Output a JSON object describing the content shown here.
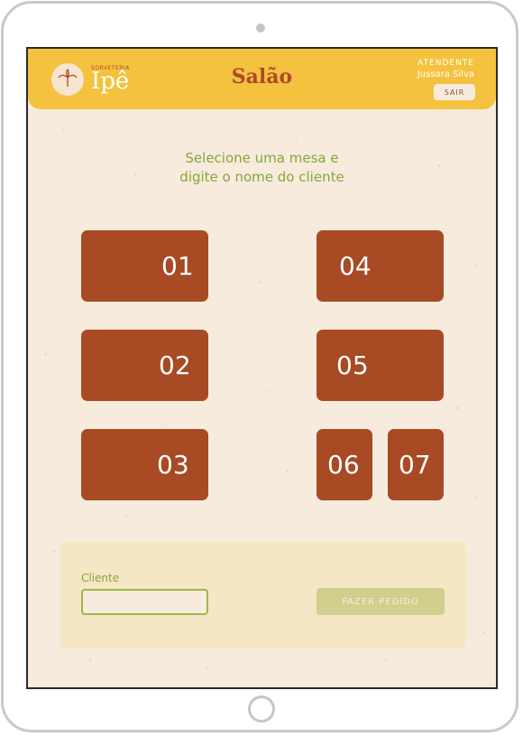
{
  "header": {
    "brand_small": "SORVETERIA",
    "brand_name": "Ipê",
    "title": "Salão",
    "attendant_label": "ATENDENTE",
    "attendant_name": "Jussara Silva",
    "logout_label": "SAIR"
  },
  "instruction": {
    "line1": "Selecione uma mesa e",
    "line2": "digite o nome do cliente"
  },
  "tables": [
    "01",
    "02",
    "03",
    "04",
    "05",
    "06",
    "07"
  ],
  "order_form": {
    "client_label": "Cliente",
    "client_value": "",
    "submit_label": "FAZER PEDIDO"
  },
  "colors": {
    "header_bg": "#f4c23e",
    "screen_bg": "#f6ebdc",
    "table_bg": "#a84a24",
    "accent_green": "#8aa53a",
    "title_color": "#b0492a"
  }
}
